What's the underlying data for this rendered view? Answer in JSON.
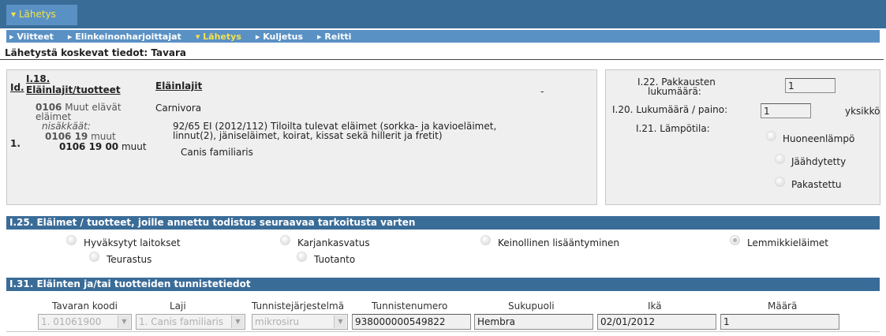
{
  "header": {
    "main_tab": "▾ Lähetys",
    "nav": [
      {
        "label": "▸ Viitteet",
        "active": false
      },
      {
        "label": "▸ Elinkeinonharjoittajat",
        "active": false
      },
      {
        "label": "▾ Lähetys",
        "active": true
      },
      {
        "label": "▸ Kuljetus",
        "active": false
      },
      {
        "label": "▸ Reitti",
        "active": false
      }
    ]
  },
  "section_title": "Lähetystä koskevat tiedot: Tavara",
  "goods": {
    "col_id": "Id.",
    "col_code_num": "I.18.",
    "col_code_label": "Eläinlajit/tuotteet",
    "col_species": "Eläinlajit",
    "dash": "-",
    "row_number": "1.",
    "code1": "0106",
    "code1_text1": "Muut elävät",
    "code1_text2": "eläimet",
    "mammals": "nisäkkäät:",
    "code2": "0106 19",
    "code2_text": "muut",
    "code3": "0106 19 00",
    "code3_text": "muut",
    "species_group": "Carnivora",
    "regulation_line1": "92/65 EI (2012/112) Tiloilta tulevat eläimet (sorkka- ja kavioeläimet,",
    "regulation_line2": "linnut(2), jäniseläimet, koirat, kissat sekä hillerit ja fretit)",
    "species": "Canis familiaris"
  },
  "quantities": {
    "packages_label_line1": "I.22. Pakkausten",
    "packages_label_line2": "lukumäärä:",
    "packages_value": "1",
    "count_label": "I.20. Lukumäärä / paino:",
    "count_value": "1",
    "count_unit": "yksikkö",
    "temperature_label": "I.21. Lämpötila:",
    "temp_options": [
      "Huoneenlämpö",
      "Jäähdytetty",
      "Pakastettu"
    ]
  },
  "purpose": {
    "title": "I.25. Eläimet / tuotteet, joille annettu todistus seuraavaa tarkoitusta varten",
    "options": [
      {
        "label": "Hyväksytyt laitokset",
        "selected": false
      },
      {
        "label": "Karjankasvatus",
        "selected": false
      },
      {
        "label": "Keinollinen lisääntyminen",
        "selected": false
      },
      {
        "label": "Lemmikkieläimet",
        "selected": true
      },
      {
        "label": "Teurastus",
        "selected": false
      },
      {
        "label": "Tuotanto",
        "selected": false
      }
    ]
  },
  "identification": {
    "title": "I.31. Eläinten ja/tai tuotteiden tunnistetiedot",
    "columns": [
      "Tavaran koodi",
      "Laji",
      "Tunnistejärjestelmä",
      "Tunnistenumero",
      "Sukupuoli",
      "Ikä",
      "Määrä"
    ],
    "row": {
      "code": "1. 01061900",
      "species": "1. Canis familiaris",
      "system": "mikrosiru",
      "id_number": "938000000549822",
      "sex": "Hembra",
      "age": "02/01/2012",
      "quantity": "1"
    }
  },
  "colors": {
    "header": "#3a6c98",
    "nav": "#5a91c4",
    "active": "#f5e24a",
    "panel": "#efefef"
  }
}
